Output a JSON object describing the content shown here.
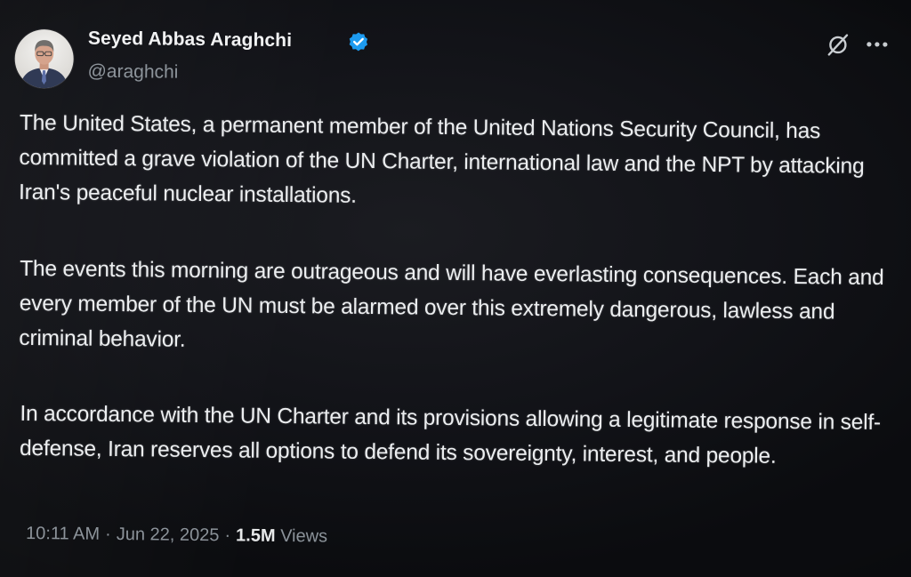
{
  "author": {
    "name": "Seyed Abbas Araghchi",
    "handle": "@araghchi"
  },
  "icons": {
    "verified": "verified-badge-icon",
    "grok": "grok-icon",
    "more": "more-options-icon"
  },
  "colors": {
    "verified_blue": "#1d9bf0",
    "text_primary": "#e7e9ea",
    "text_secondary": "#8b9299",
    "background": "#15161a"
  },
  "tweet": {
    "paragraphs": [
      "The United States, a permanent member of the United Nations Security Council, has committed a grave violation of the UN Charter, international law and the NPT by attacking Iran's peaceful nuclear installations.",
      "The events this morning are outrageous and will have everlasting consequences. Each and every member of the UN must be alarmed over this extremely dangerous, lawless and criminal behavior.",
      "In accordance with the UN Charter and its provisions allowing a legitimate response in self-defense, Iran reserves all options to defend its sovereignty, interest, and people."
    ],
    "time": "10:11 AM",
    "date": "Jun 22, 2025",
    "views_count": "1.5M",
    "views_label": "Views",
    "separator": "·"
  }
}
